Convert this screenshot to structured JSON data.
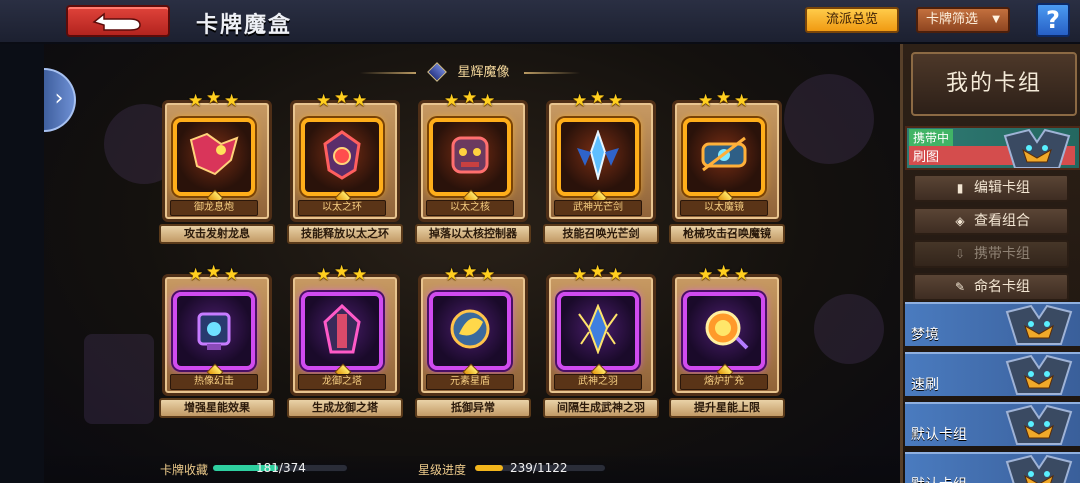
{
  "header": {
    "title": "卡牌魔盒",
    "overview_label": "流派总览",
    "filter_label": "卡牌筛选",
    "help_label": "?"
  },
  "section": {
    "title": "星辉魔像"
  },
  "cards": [
    {
      "name": "御龙息炮",
      "effect": "攻击发射龙息",
      "rarity": "orange",
      "stars": 3
    },
    {
      "name": "以太之环",
      "effect": "技能释放以太之环",
      "rarity": "orange",
      "stars": 3
    },
    {
      "name": "以太之核",
      "effect": "掉落以太核控制器",
      "rarity": "orange",
      "stars": 3
    },
    {
      "name": "武神光芒剑",
      "effect": "技能召唤光芒剑",
      "rarity": "orange",
      "stars": 3
    },
    {
      "name": "以太魔镜",
      "effect": "枪械攻击召唤魔镜",
      "rarity": "orange",
      "stars": 3
    },
    {
      "name": "热像幻击",
      "effect": "增强星能效果",
      "rarity": "purple",
      "stars": 3
    },
    {
      "name": "龙御之塔",
      "effect": "生成龙御之塔",
      "rarity": "purple",
      "stars": 3
    },
    {
      "name": "元素星盾",
      "effect": "抵御异常",
      "rarity": "purple",
      "stars": 3
    },
    {
      "name": "武神之羽",
      "effect": "间隔生成武神之羽",
      "rarity": "purple",
      "stars": 3
    },
    {
      "name": "熔炉扩充",
      "effect": "提升星能上限",
      "rarity": "purple",
      "stars": 3
    }
  ],
  "progress": {
    "collection_label": "卡牌收藏",
    "collection_value": "181/374",
    "collection_fraction": 0.484,
    "star_label": "星级进度",
    "star_value": "239/1122",
    "star_fraction": 0.213
  },
  "deck_panel": {
    "title": "我的卡组",
    "active_deck": {
      "tag": "携带中",
      "name": "刷图"
    },
    "actions": [
      {
        "label": "编辑卡组",
        "icon": "clipboard-icon",
        "enabled": true
      },
      {
        "label": "查看组合",
        "icon": "eye-icon",
        "enabled": true
      },
      {
        "label": "携带卡组",
        "icon": "download-icon",
        "enabled": false
      },
      {
        "label": "命名卡组",
        "icon": "pencil-icon",
        "enabled": true
      }
    ],
    "decks": [
      {
        "name": "梦境"
      },
      {
        "name": "速刷"
      },
      {
        "name": "默认卡组"
      },
      {
        "name": "默认卡组"
      }
    ]
  },
  "colors": {
    "orange_rarity": "#ffae1a",
    "purple_rarity": "#d04bf0",
    "collection_bar": "#2fd0a0",
    "star_bar": "#f2b51c"
  }
}
